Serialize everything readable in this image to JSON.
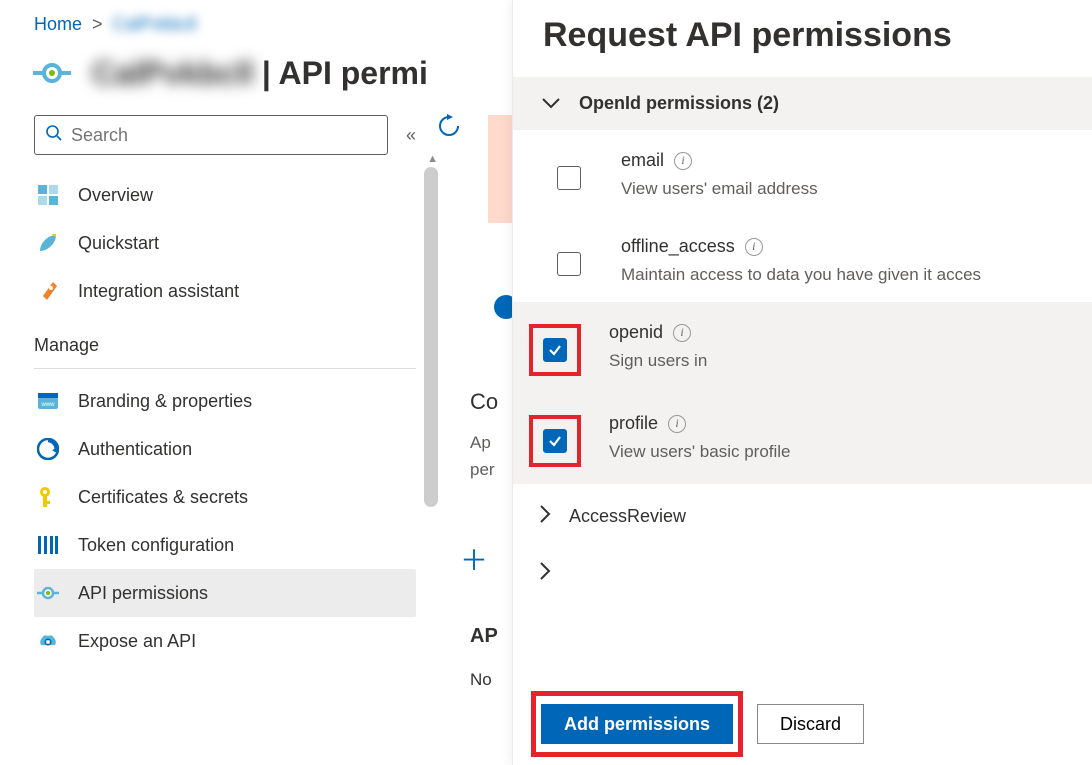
{
  "breadcrumb": {
    "home": "Home",
    "app_name": "CalPvkbcll"
  },
  "page": {
    "app_name": "CalPvkbcll",
    "title_suffix": "| API permi"
  },
  "search": {
    "placeholder": "Search"
  },
  "nav": {
    "overview": "Overview",
    "quickstart": "Quickstart",
    "integration": "Integration assistant",
    "manage_header": "Manage",
    "branding": "Branding & properties",
    "authentication": "Authentication",
    "certificates": "Certificates & secrets",
    "token": "Token configuration",
    "api_permissions": "API permissions",
    "expose": "Expose an API"
  },
  "content": {
    "heading": "Co",
    "p1a": "Ap",
    "p1b": "per",
    "sub_heading": "AP",
    "p2": "No"
  },
  "panel": {
    "title": "Request API permissions",
    "group_label": "OpenId permissions (2)",
    "perms": {
      "email": {
        "name": "email",
        "desc": "View users' email address",
        "checked": false
      },
      "offline": {
        "name": "offline_access",
        "desc": "Maintain access to data you have given it acces",
        "checked": false
      },
      "openid": {
        "name": "openid",
        "desc": "Sign users in",
        "checked": true
      },
      "profile": {
        "name": "profile",
        "desc": "View users' basic profile",
        "checked": true
      }
    },
    "access_review": "AccessReview",
    "footer": {
      "add": "Add permissions",
      "discard": "Discard"
    }
  }
}
